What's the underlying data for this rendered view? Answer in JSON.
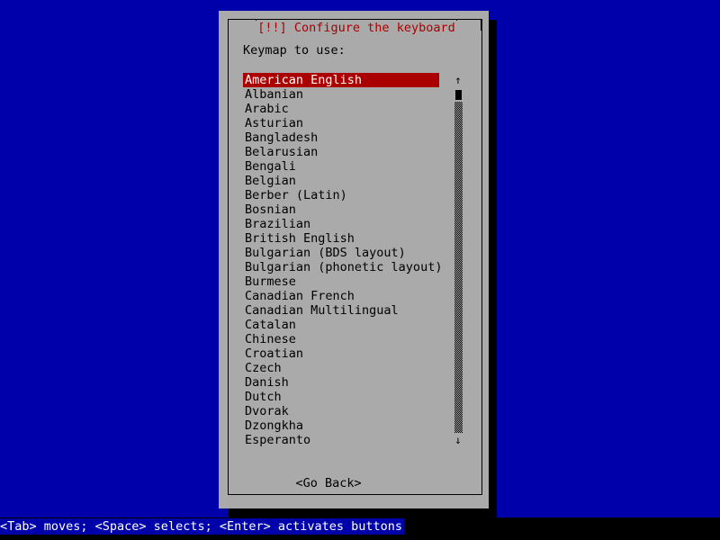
{
  "screen": {
    "background_color": "#0000aa",
    "terminal_black": "#000000"
  },
  "dialog": {
    "title": "[!!] Configure the keyboard",
    "title_color": "#aa0000",
    "background_color": "#aaaaaa",
    "border_color": "#000000",
    "prompt": "Keymap to use:"
  },
  "list": {
    "selected_index": 0,
    "selected_bg_color": "#aa0000",
    "selected_fg_color": "#ffffff",
    "items": [
      "American English",
      "Albanian",
      "Arabic",
      "Asturian",
      "Bangladesh",
      "Belarusian",
      "Bengali",
      "Belgian",
      "Berber (Latin)",
      "Bosnian",
      "Brazilian",
      "British English",
      "Bulgarian (BDS layout)",
      "Bulgarian (phonetic layout)",
      "Burmese",
      "Canadian French",
      "Canadian Multilingual",
      "Catalan",
      "Chinese",
      "Croatian",
      "Czech",
      "Danish",
      "Dutch",
      "Dvorak",
      "Dzongkha",
      "Esperanto"
    ]
  },
  "scrollbar": {
    "up_arrow": "↑",
    "down_arrow": "↓"
  },
  "buttons": {
    "go_back": "<Go Back>"
  },
  "statusbar": {
    "text": "<Tab> moves; <Space> selects; <Enter> activates buttons",
    "background_color": "#0000aa",
    "text_color": "#ffffff"
  }
}
